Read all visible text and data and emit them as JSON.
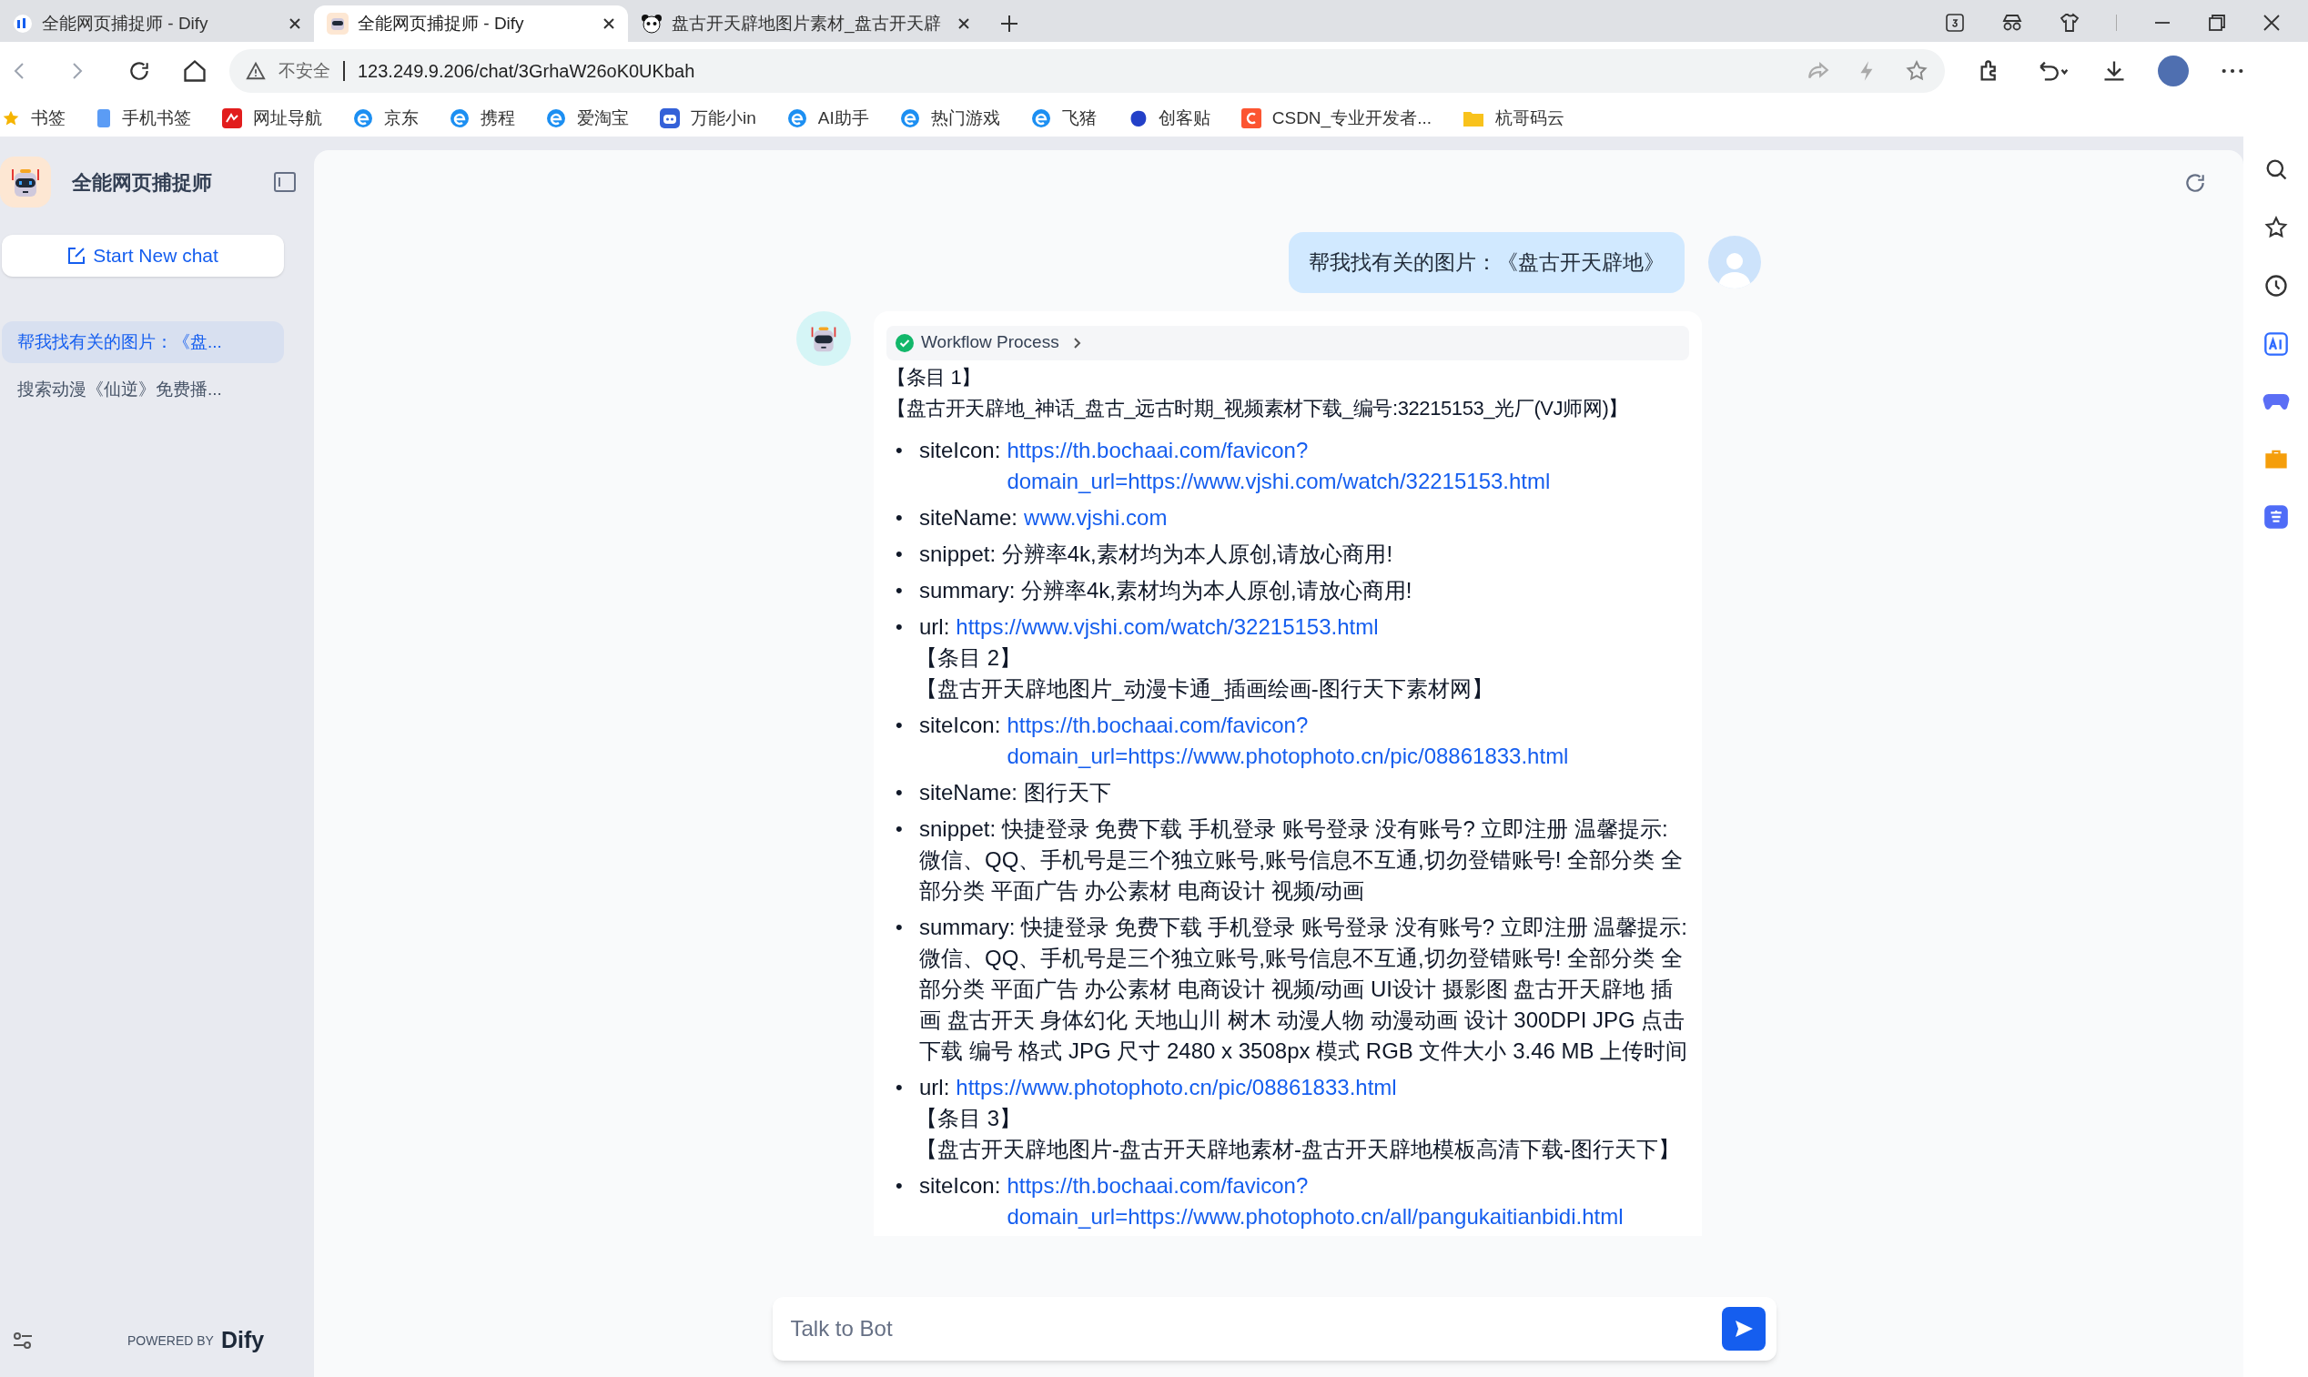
{
  "browser": {
    "tabs": [
      {
        "title": "全能网页捕捉师 - Dify",
        "selected": false
      },
      {
        "title": "全能网页捕捉师 - Dify",
        "selected": true
      },
      {
        "title": "盘古开天辟地图片素材_盘古开天辟",
        "selected": false
      }
    ],
    "address": {
      "warning": "不安全",
      "url": "123.249.9.206/chat/3GrhaW26oK0UKbah"
    },
    "bookmarks": [
      {
        "label": "书签"
      },
      {
        "label": "手机书签"
      },
      {
        "label": "网址导航"
      },
      {
        "label": "京东"
      },
      {
        "label": "携程"
      },
      {
        "label": "爱淘宝"
      },
      {
        "label": "万能小in"
      },
      {
        "label": "AI助手"
      },
      {
        "label": "热门游戏"
      },
      {
        "label": "飞猪"
      },
      {
        "label": "创客贴"
      },
      {
        "label": "CSDN_专业开发者..."
      },
      {
        "label": "杭哥码云"
      }
    ]
  },
  "sidebar": {
    "app_name": "全能网页捕捉师",
    "new_chat": "Start New chat",
    "conversations": [
      {
        "title": "帮我找有关的图片：《盘...",
        "selected": true
      },
      {
        "title": "搜索动漫《仙逆》免费播...",
        "selected": false
      }
    ],
    "powered_by": "POWERED BY",
    "brand": "Dify"
  },
  "chat": {
    "user_message": "帮我找有关的图片：《盘古开天辟地》",
    "workflow": {
      "label": "Workflow Process"
    },
    "answer": [
      {
        "kind": "heading",
        "text": "【条目 1】"
      },
      {
        "kind": "heading",
        "text": "【盘古开天辟地_神话_盘古_远古时期_视频素材下载_编号:32215153_光厂(VJ师网)】"
      },
      {
        "kind": "item",
        "marker": "•",
        "key": "siteIcon:",
        "value": "https://th.bochaai.com/favicon?domain_url=https://www.vjshi.com/watch/32215153.html",
        "link": true
      },
      {
        "kind": "item",
        "marker": "•",
        "key": "siteName:",
        "value": "www.vjshi.com",
        "link": true
      },
      {
        "kind": "item",
        "marker": "•",
        "key": "snippet:",
        "value": "分辨率4k,素材均为本人原创,请放心商用!",
        "link": false
      },
      {
        "kind": "item",
        "marker": "•",
        "key": "summary:",
        "value": "分辨率4k,素材均为本人原创,请放心商用!",
        "link": false
      },
      {
        "kind": "item",
        "marker": "•",
        "key": "url:",
        "value": "https://www.vjshi.com/watch/32215153.html",
        "link": true,
        "after": [
          "【条目 2】",
          "【盘古开天辟地图片_动漫卡通_插画绘画-图行天下素材网】"
        ]
      },
      {
        "kind": "item",
        "marker": "•",
        "key": "siteIcon:",
        "value": "https://th.bochaai.com/favicon?domain_url=https://www.photophoto.cn/pic/08861833.html",
        "link": true
      },
      {
        "kind": "item",
        "marker": "•",
        "key": "siteName:",
        "value": "图行天下",
        "link": false
      },
      {
        "kind": "item",
        "marker": "•",
        "key": "snippet:",
        "value": "快捷登录 免费下载 手机登录 账号登录 没有账号? 立即注册 温馨提示:微信、QQ、手机号是三个独立账号,账号信息不互通,切勿登错账号! 全部分类 全部分类 平面广告 办公素材 电商设计 视频/动画",
        "link": false
      },
      {
        "kind": "item",
        "marker": "•",
        "key": "summary:",
        "value": "快捷登录 免费下载 手机登录 账号登录 没有账号? 立即注册 温馨提示:微信、QQ、手机号是三个独立账号,账号信息不互通,切勿登错账号! 全部分类 全部分类 平面广告 办公素材 电商设计 视频/动画 UI设计 摄影图 盘古开天辟地 插画 盘古开天 身体幻化 天地山川 树木 动漫人物 动漫动画 设计 300DPI JPG 点击下载 编号 格式 JPG 尺寸 2480 x 3508px 模式 RGB 文件大小 3.46 MB 上传时间",
        "link": false
      },
      {
        "kind": "item",
        "marker": "•",
        "key": "url:",
        "value": "https://www.photophoto.cn/pic/08861833.html",
        "link": true,
        "after": [
          "【条目 3】",
          "【盘古开天辟地图片-盘古开天辟地素材-盘古开天辟地模板高清下载-图行天下】"
        ]
      },
      {
        "kind": "item",
        "marker": "•",
        "key": "siteIcon:",
        "value": "https://th.bochaai.com/favicon?domain_url=https://www.photophoto.cn/all/pangukaitianbidi.html",
        "link": true
      }
    ],
    "input": {
      "placeholder": "Talk to Bot"
    }
  }
}
